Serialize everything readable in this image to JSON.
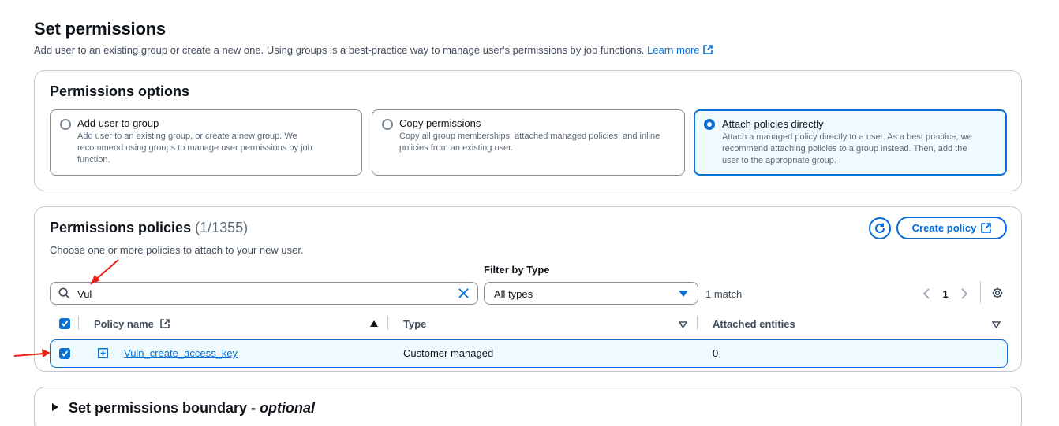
{
  "header": {
    "title": "Set permissions",
    "description": "Add user to an existing group or create a new one. Using groups is a best-practice way to manage user's permissions by job functions.",
    "learn_more": "Learn more"
  },
  "permissions_options": {
    "heading": "Permissions options",
    "options": [
      {
        "title": "Add user to group",
        "desc_line1": "Add user to an existing group, or create a new group. We",
        "desc_line2": "recommend using groups to manage user permissions by job",
        "desc_line3": "function.",
        "selected": false
      },
      {
        "title": "Copy permissions",
        "desc_line1": "Copy all group memberships, attached managed policies, and inline",
        "desc_line2": "policies from an existing user.",
        "desc_line3": "",
        "selected": false
      },
      {
        "title": "Attach policies directly",
        "desc_line1": "Attach a managed policy directly to a user. As a best practice, we",
        "desc_line2": "recommend attaching policies to a group instead. Then, add the",
        "desc_line3": "user to the appropriate group.",
        "selected": true
      }
    ]
  },
  "permissions_policies": {
    "heading": "Permissions policies",
    "count": "(1/1355)",
    "subtext": "Choose one or more policies to attach to your new user.",
    "create_policy_label": "Create policy",
    "search_value": "Vul",
    "filter_label": "Filter by Type",
    "filter_value": "All types",
    "match_text": "1 match",
    "page_number": "1",
    "columns": {
      "policy_name": "Policy name",
      "type": "Type",
      "attached_entities": "Attached entities"
    },
    "rows": [
      {
        "policy_name": "Vuln_create_access_key",
        "type": "Customer managed",
        "attached_entities": "0",
        "checked": true
      }
    ]
  },
  "boundary": {
    "title": "Set permissions boundary - ",
    "optional": "optional"
  },
  "colors": {
    "accent": "#0972d3",
    "selected_bg": "#f0fbff",
    "annotation": "#e8231c"
  }
}
